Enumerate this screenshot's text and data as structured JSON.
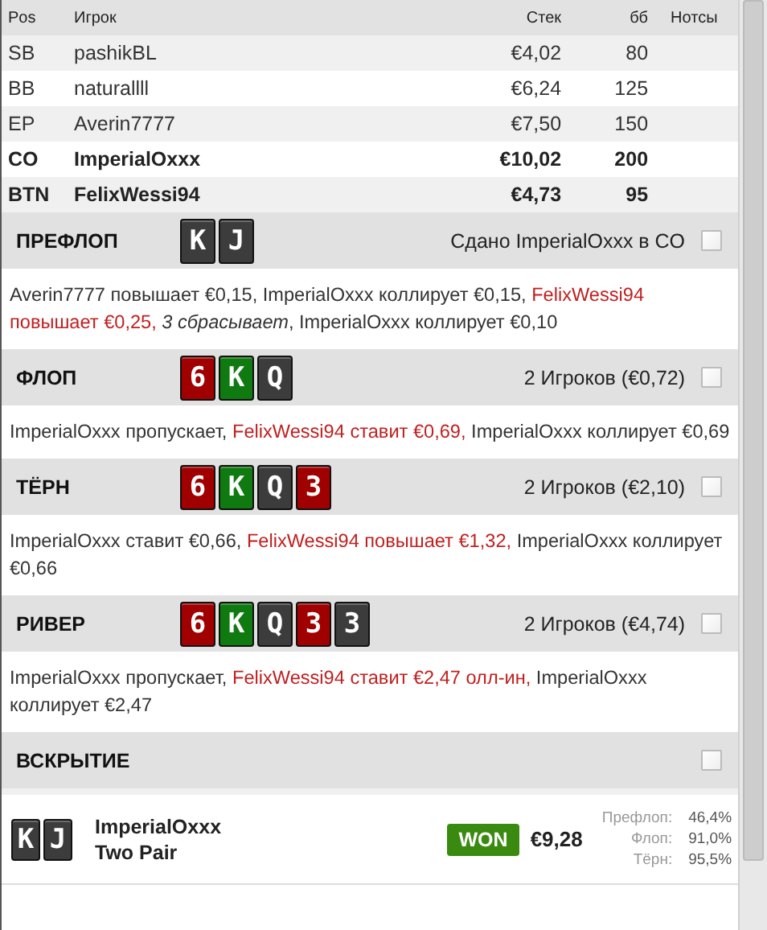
{
  "table": {
    "columns": [
      "Pos",
      "Игрок",
      "Стек",
      "бб",
      "Нотсы"
    ],
    "rows": [
      {
        "pos": "SB",
        "player": "pashikBL",
        "stack": "€4,02",
        "bb": "80",
        "bold": false
      },
      {
        "pos": "BB",
        "player": "naturallll",
        "stack": "€6,24",
        "bb": "125",
        "bold": false
      },
      {
        "pos": "EP",
        "player": "Averin7777",
        "stack": "€7,50",
        "bb": "150",
        "bold": false
      },
      {
        "pos": "CO",
        "player": "ImperialOxxx",
        "stack": "€10,02",
        "bb": "200",
        "bold": true
      },
      {
        "pos": "BTN",
        "player": "FelixWessi94",
        "stack": "€4,73",
        "bb": "95",
        "bold": true
      }
    ]
  },
  "streets": [
    {
      "name": "ПРЕФЛОП",
      "cards": [
        {
          "rank": "K",
          "color": "#3c3c3c"
        },
        {
          "rank": "J",
          "color": "#3c3c3c"
        }
      ],
      "summary": "Сдано ImperialOxxx в CO",
      "actions": [
        {
          "kind": "plain",
          "text": "Averin7777 повышает €0,15, ImperialOxxx коллирует €0,15, "
        },
        {
          "kind": "bet",
          "text": "FelixWessi94 повышает €0,25, "
        },
        {
          "kind": "fold",
          "text": "3 сбрасывает"
        },
        {
          "kind": "plain",
          "text": ", ImperialOxxx коллирует €0,10"
        }
      ]
    },
    {
      "name": "ФЛОП",
      "cards": [
        {
          "rank": "6",
          "color": "#a00000"
        },
        {
          "rank": "K",
          "color": "#0f7a0f"
        },
        {
          "rank": "Q",
          "color": "#3c3c3c"
        }
      ],
      "summary": "2 Игроков (€0,72)",
      "actions": [
        {
          "kind": "plain",
          "text": "ImperialOxxx пропускает, "
        },
        {
          "kind": "bet",
          "text": "FelixWessi94 ставит €0,69, "
        },
        {
          "kind": "plain",
          "text": "ImperialOxxx коллирует €0,69"
        }
      ]
    },
    {
      "name": "ТЁРН",
      "cards": [
        {
          "rank": "6",
          "color": "#a00000"
        },
        {
          "rank": "K",
          "color": "#0f7a0f"
        },
        {
          "rank": "Q",
          "color": "#3c3c3c"
        },
        {
          "rank": "3",
          "color": "#a00000"
        }
      ],
      "summary": "2 Игроков (€2,10)",
      "actions": [
        {
          "kind": "plain",
          "text": "ImperialOxxx ставит €0,66, "
        },
        {
          "kind": "bet",
          "text": "FelixWessi94 повышает €1,32, "
        },
        {
          "kind": "plain",
          "text": "ImperialOxxx коллирует €0,66"
        }
      ]
    },
    {
      "name": "РИВЕР",
      "cards": [
        {
          "rank": "6",
          "color": "#a00000"
        },
        {
          "rank": "K",
          "color": "#0f7a0f"
        },
        {
          "rank": "Q",
          "color": "#3c3c3c"
        },
        {
          "rank": "3",
          "color": "#a00000"
        },
        {
          "rank": "3",
          "color": "#3c3c3c"
        }
      ],
      "summary": "2 Игроков (€4,74)",
      "actions": [
        {
          "kind": "plain",
          "text": "ImperialOxxx пропускает, "
        },
        {
          "kind": "bet",
          "text": "FelixWessi94 ставит €2,47 олл-ин, "
        },
        {
          "kind": "plain",
          "text": "ImperialOxxx коллирует €2,47"
        }
      ]
    }
  ],
  "showdown": {
    "title": "ВСКРЫТИЕ",
    "players": [
      {
        "cards": [
          {
            "rank": "K",
            "color": "#3c3c3c"
          },
          {
            "rank": "J",
            "color": "#3c3c3c"
          }
        ],
        "name": "ImperialOxxx",
        "hand": "Two Pair",
        "result": "WON",
        "amount": "€9,28",
        "equity": [
          {
            "label": "Префлоп:",
            "value": "46,4%"
          },
          {
            "label": "Флоп:",
            "value": "91,0%"
          },
          {
            "label": "Тёрн:",
            "value": "95,5%"
          }
        ]
      }
    ]
  }
}
